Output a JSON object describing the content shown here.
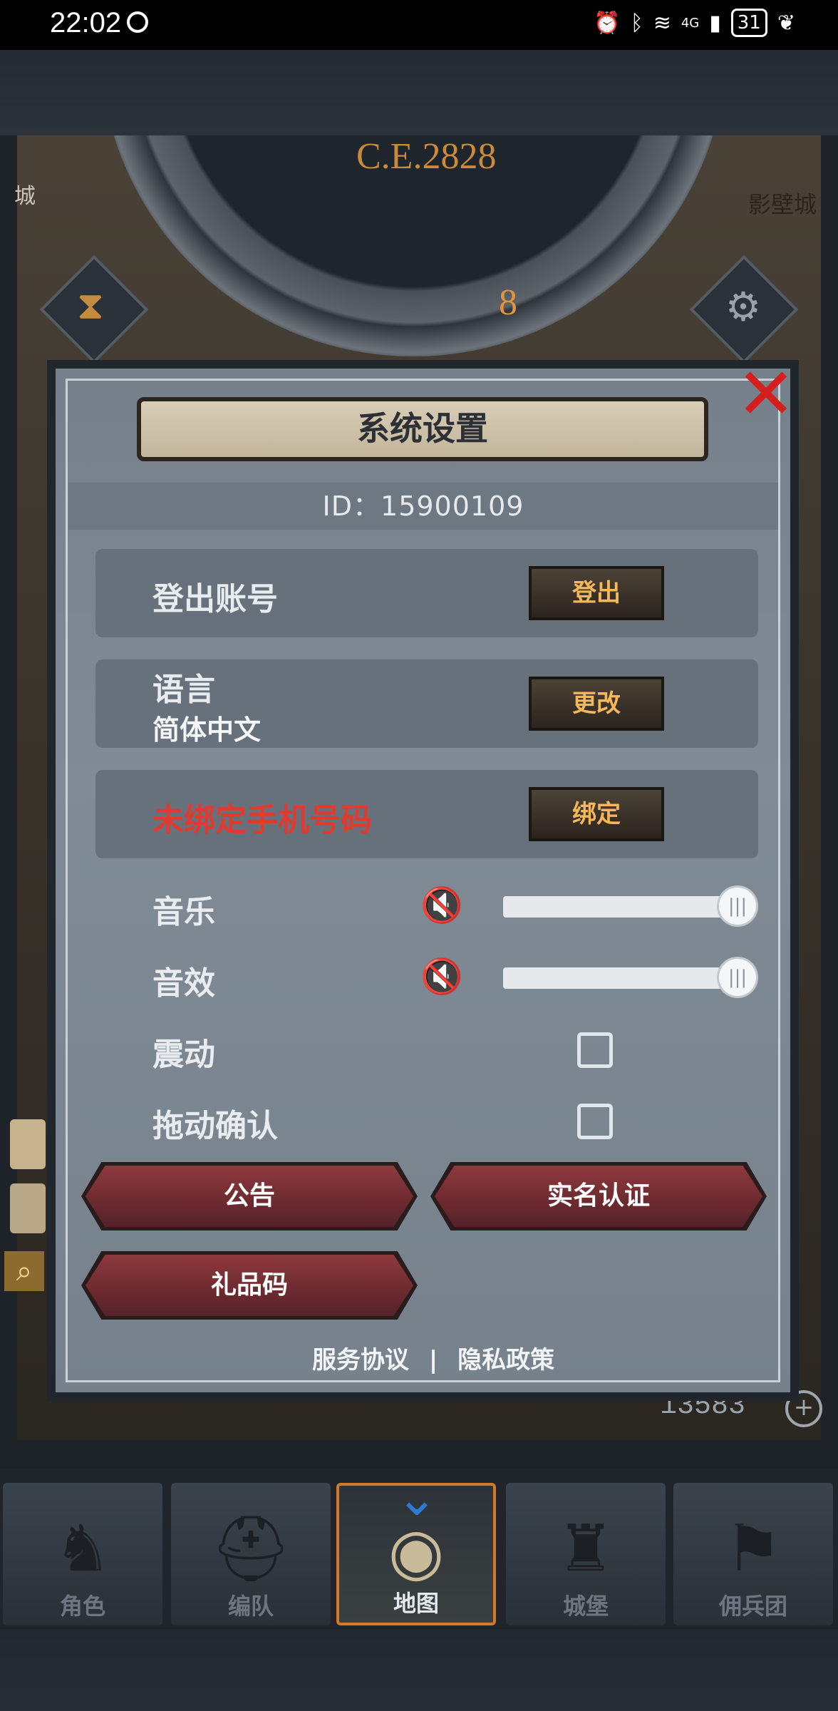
{
  "status_bar": {
    "time": "22:02",
    "signal": "4G",
    "battery": "31"
  },
  "background": {
    "year": "C.E.2828",
    "month": "8",
    "left_text": "城",
    "right_text": "影壁城",
    "currency": "13583"
  },
  "dialog": {
    "title": "系统设置",
    "id_text": "ID：15900109",
    "logout": {
      "label": "登出账号",
      "button": "登出"
    },
    "language": {
      "label": "语言",
      "value": "简体中文",
      "button": "更改"
    },
    "phone": {
      "label": "未绑定手机号码",
      "button": "绑定",
      "label_color": "#e23a2e"
    },
    "music": {
      "label": "音乐",
      "volume": 1.0,
      "muted": true
    },
    "sound": {
      "label": "音效",
      "volume": 1.0,
      "muted": true
    },
    "vibration": {
      "label": "震动",
      "checked": false
    },
    "drag_confirm": {
      "label": "拖动确认",
      "checked": false
    },
    "buttons": {
      "notice": "公告",
      "realname": "实名认证",
      "giftcode": "礼品码"
    },
    "footer": {
      "service": "服务协议",
      "separator": "|",
      "privacy": "隐私政策"
    }
  },
  "nav": {
    "tabs": [
      {
        "label": "角色",
        "icon": "knight-icon"
      },
      {
        "label": "编队",
        "icon": "helmet-icon"
      },
      {
        "label": "地图",
        "icon": "globe-icon",
        "active": true
      },
      {
        "label": "城堡",
        "icon": "castle-icon"
      },
      {
        "label": "佣兵团",
        "icon": "banner-icon"
      }
    ]
  }
}
